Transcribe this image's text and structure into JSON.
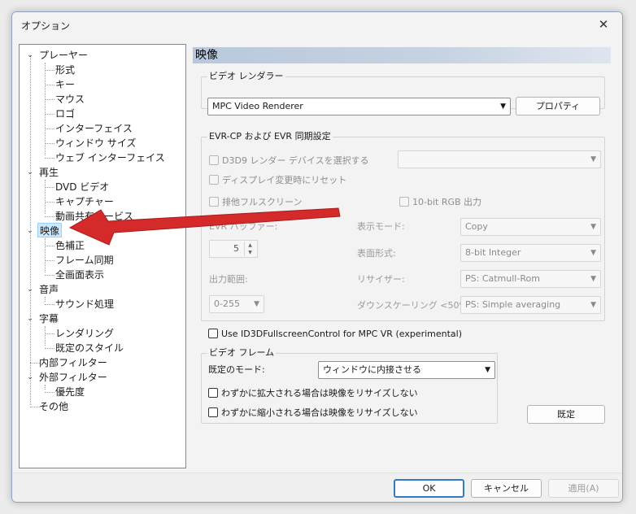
{
  "window": {
    "title": "オプション",
    "close_glyph": "✕"
  },
  "tree": {
    "player": "プレーヤー",
    "player_children": [
      "形式",
      "キー",
      "マウス",
      "ロゴ",
      "インターフェイス",
      "ウィンドウ サイズ",
      "ウェブ インターフェイス"
    ],
    "playback": "再生",
    "playback_children": [
      "DVD ビデオ",
      "キャプチャー",
      "動画共有サービス"
    ],
    "video": "映像",
    "video_children": [
      "色補正",
      "フレーム同期",
      "全画面表示"
    ],
    "audio": "音声",
    "audio_children": [
      "サウンド処理"
    ],
    "subtitles": "字幕",
    "subtitles_children": [
      "レンダリング",
      "既定のスタイル"
    ],
    "internal_filters": "内部フィルター",
    "external_filters": "外部フィルター",
    "external_children": [
      "優先度"
    ],
    "other": "その他"
  },
  "section": {
    "title": "映像"
  },
  "renderer_group": {
    "label": "ビデオ レンダラー",
    "renderer_value": "MPC Video Renderer",
    "properties_button": "プロパティ"
  },
  "evr_group": {
    "label": "EVR-CP および EVR 同期設定",
    "d3d9_checkbox": "D3D9 レンダー デバイスを選択する",
    "reset_checkbox": "ディスプレイ変更時にリセット",
    "exclusive_checkbox": "排他フルスクリーン",
    "tenbit_checkbox": "10-bit RGB 出力",
    "evr_buffer_label": "EVR バッファー:",
    "evr_buffer_value": "5",
    "output_range_label": "出力範囲:",
    "output_range_value": "0-255",
    "display_mode_label": "表示モード:",
    "display_mode_value": "Copy",
    "surface_label": "表面形式:",
    "surface_value": "8-bit Integer",
    "resizer_label": "リサイザー:",
    "resizer_value": "PS: Catmull-Rom",
    "downscale_label": "ダウンスケーリング <50%:",
    "downscale_value": "PS: Simple averaging"
  },
  "fullscreen_control": "Use ID3DFullscreenControl for MPC VR (experimental)",
  "frame_group": {
    "label": "ビデオ フレーム",
    "default_mode_label": "既定のモード:",
    "default_mode_value": "ウィンドウに内接させる",
    "no_enlarge": "わずかに拡大される場合は映像をリサイズしない",
    "no_shrink": "わずかに縮小される場合は映像をリサイズしない"
  },
  "defaults_button": "既定",
  "footer": {
    "ok": "OK",
    "cancel": "キャンセル",
    "apply": "適用(A)"
  },
  "colors": {
    "arrow": "#d42a2a",
    "header_gradient": "#b8c8dc",
    "selection": "#cce8ff",
    "primary_border": "#3278c8"
  }
}
